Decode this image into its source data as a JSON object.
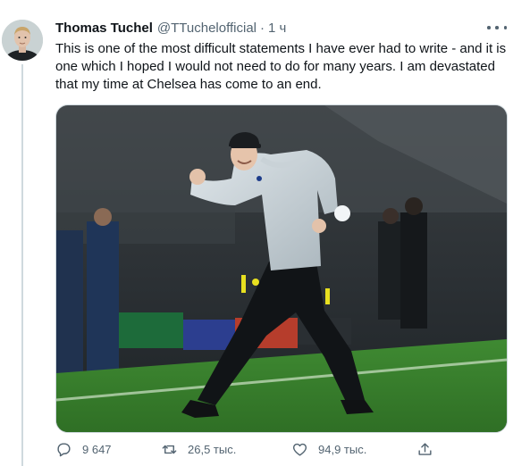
{
  "tweet": {
    "author": {
      "display_name": "Thomas Tuchel",
      "handle": "@TTuchelofficial",
      "separator": "·",
      "time": "1 ч"
    },
    "text": "This is one of the most difficult statements I have ever had to write - and it is one which I hoped I would not need to do for many years. I am devastated that my time at Chelsea has come to an end.",
    "media": {
      "subject": "celebrating-coach-photo"
    },
    "actions": {
      "reply_count": "9 647",
      "retweet_count": "26,5 тыс.",
      "like_count": "94,9 тыс."
    }
  },
  "icons": {
    "reply": "reply-icon",
    "retweet": "retweet-icon",
    "like": "like-icon",
    "share": "share-icon",
    "more": "more-icon"
  },
  "colors": {
    "text_primary": "#0f1419",
    "text_secondary": "#536471",
    "border": "#cfd9de"
  }
}
